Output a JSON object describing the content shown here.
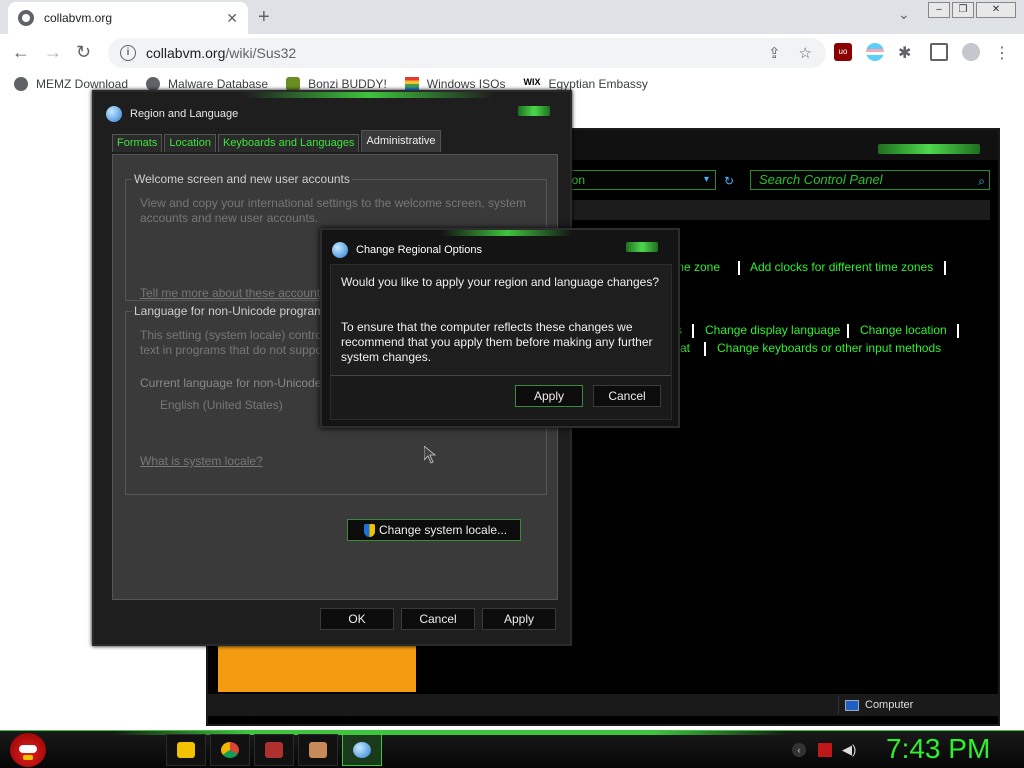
{
  "browser": {
    "tab_title": "collabvm.org",
    "tab_close": "✕",
    "new_tab": "+",
    "url_domain": "collabvm.org",
    "url_path": "/wiki/Sus32",
    "bookmarks": [
      {
        "label": "MEMZ Download",
        "icon": "globe-icon"
      },
      {
        "label": "Malware Database",
        "icon": "globe-icon"
      },
      {
        "label": "Bonzi BUDDY!",
        "icon": "bonzi-icon"
      },
      {
        "label": "Windows ISOs",
        "icon": "windows-flag-icon"
      },
      {
        "label": "Egyptian Embassy",
        "icon": "wix-icon"
      }
    ],
    "wix_text": "WIX"
  },
  "control_panel": {
    "address_fragment": "ion",
    "search_placeholder": "Search Control Panel",
    "links": {
      "time_zone": "me zone",
      "add_clocks": "Add clocks for different time zones",
      "s_fragment": "s",
      "change_display_language": "Change display language",
      "change_location": "Change location",
      "at_fragment": "at",
      "change_keyboards": "Change keyboards or other input methods"
    },
    "status_computer": "Computer"
  },
  "region_dialog": {
    "title": "Region and Language",
    "tabs": [
      "Formats",
      "Location",
      "Keyboards and Languages",
      "Administrative"
    ],
    "active_tab": "Administrative",
    "welcome_group": "Welcome screen and new user accounts",
    "welcome_text": "View and copy your international settings to the welcome screen, system accounts and new user accounts.",
    "welcome_link": "Tell me more about these accounts",
    "nonunicode_group": "Language for non-Unicode programs",
    "nonunicode_text": "This setting (system locale) controls the language used when displaying text in programs that do not support Unicode.",
    "current_lang_label": "Current language for non-Unicode programs:",
    "current_lang_value": "English (United States)",
    "change_locale_button": "Change system locale...",
    "system_locale_link": "What is system locale?",
    "ok": "OK",
    "cancel": "Cancel",
    "apply": "Apply"
  },
  "confirm_dialog": {
    "title": "Change Regional Options",
    "message1": "Would you like to apply your region and language changes?",
    "message2": "To ensure that the computer reflects these changes we recommend that you apply them before making any further system changes.",
    "apply": "Apply",
    "cancel": "Cancel"
  },
  "taskbar": {
    "clock": "7:43 PM",
    "pinned": [
      "explorer-folder-icon",
      "chrome-icon",
      "control-panel-icon",
      "app-icon",
      "region-language-icon"
    ]
  },
  "colors": {
    "accent_green": "#2ef02e",
    "window_dark": "#1e1e1e",
    "orange_block": "#f39c12"
  }
}
